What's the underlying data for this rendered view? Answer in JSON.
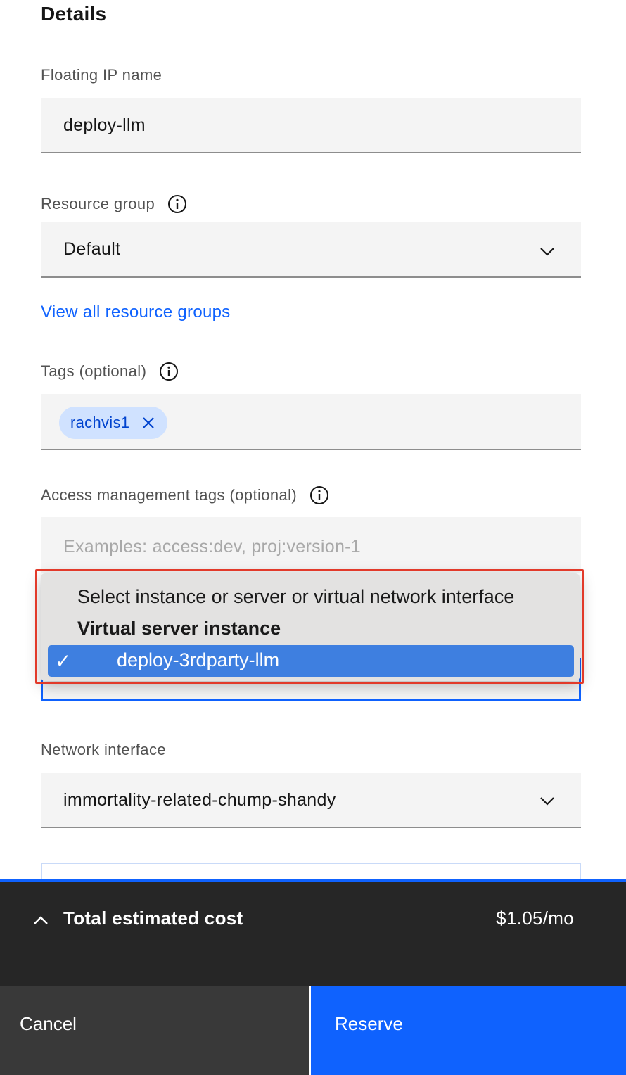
{
  "details": {
    "heading": "Details",
    "floating_ip": {
      "label": "Floating IP name",
      "value": "deploy-llm"
    },
    "resource_group": {
      "label": "Resource group",
      "value": "Default",
      "link": "View all resource groups"
    },
    "tags": {
      "label": "Tags (optional)",
      "items": [
        {
          "label": "rachvis1"
        }
      ]
    },
    "access_tags": {
      "label": "Access management tags (optional)",
      "placeholder": "Examples: access:dev, proj:version-1"
    },
    "instance_dropdown": {
      "prompt_option": "Select instance or server or virtual network interface",
      "group_label": "Virtual server instance",
      "selected_option": "deploy-3rdparty-llm"
    },
    "network_interface": {
      "label": "Network interface",
      "value": "immortality-related-chump-shandy"
    }
  },
  "footer": {
    "cost_label": "Total estimated cost",
    "cost_value": "$1.05/mo",
    "cancel_label": "Cancel",
    "reserve_label": "Reserve"
  },
  "colors": {
    "accent": "#0f62fe",
    "highlight": "#e23a2a",
    "tag_bg": "#d0e2ff",
    "selected_option_bg": "#3e7fe0"
  }
}
